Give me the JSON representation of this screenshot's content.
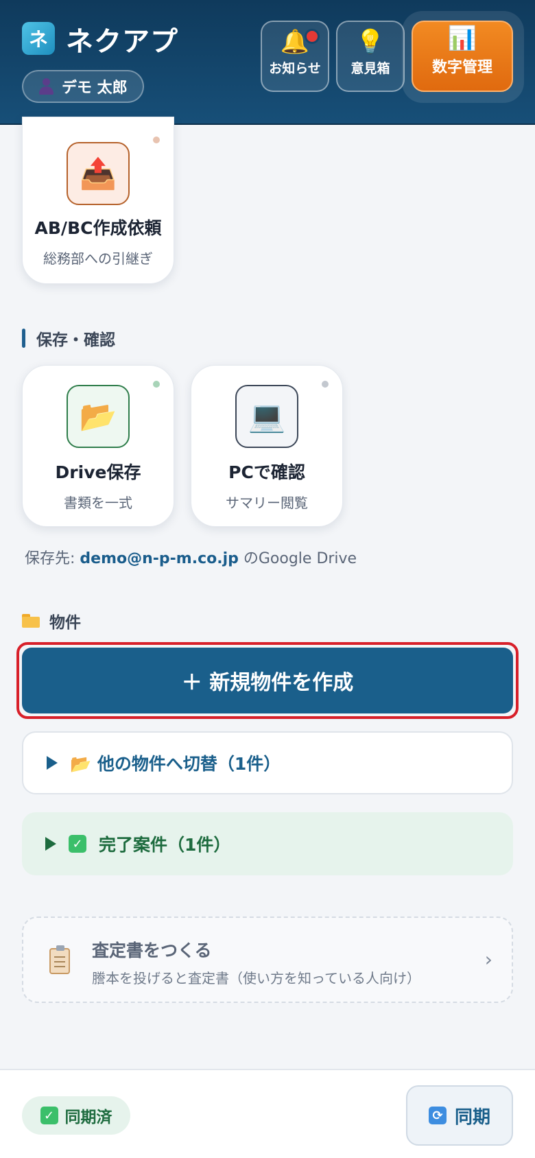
{
  "header": {
    "logo_glyph": "ネ",
    "app_title": "ネクアプ",
    "user_name": "デモ 太郎",
    "buttons": {
      "notice": {
        "label": "お知らせ",
        "icon": "bell-icon",
        "glyph": "🔔"
      },
      "idea": {
        "label": "意見箱",
        "icon": "lightbulb-icon",
        "glyph": "💡"
      },
      "numbers": {
        "label": "数字管理",
        "icon": "bar-chart-icon",
        "glyph": "📊"
      }
    }
  },
  "cards": {
    "ab_bc": {
      "title": "AB/BC作成依頼",
      "subtitle": "総務部への引継ぎ",
      "icon": "upload-tray-icon",
      "glyph": "📤"
    },
    "drive": {
      "title": "Drive保存",
      "subtitle": "書類を一式",
      "icon": "folder-icon",
      "glyph": "📂"
    },
    "pc": {
      "title": "PCで確認",
      "subtitle": "サマリー閲覧",
      "icon": "laptop-icon",
      "glyph": "💻"
    }
  },
  "sections": {
    "save_confirm": "保存・確認",
    "properties": "物件"
  },
  "save_note": {
    "prefix": "保存先: ",
    "email": "demo@n-p-m.co.jp",
    "suffix": " のGoogle Drive"
  },
  "actions": {
    "create_property": "＋ 新規物件を作成",
    "switch_property": "📂 他の物件へ切替（1件）",
    "completed": "完了案件（1件）"
  },
  "appraisal": {
    "title": "査定書をつくる",
    "subtitle": "謄本を投げると査定書（使い方を知っている人向け）",
    "chevron": "›"
  },
  "footer": {
    "synced_label": "同期済",
    "sync_button": "同期"
  },
  "colors": {
    "header_bg": "#174f78",
    "accent_orange": "#e06a0f",
    "primary_blue": "#1a5f8b",
    "success_green": "#1d6b3e",
    "highlight_red": "#d8202a"
  }
}
